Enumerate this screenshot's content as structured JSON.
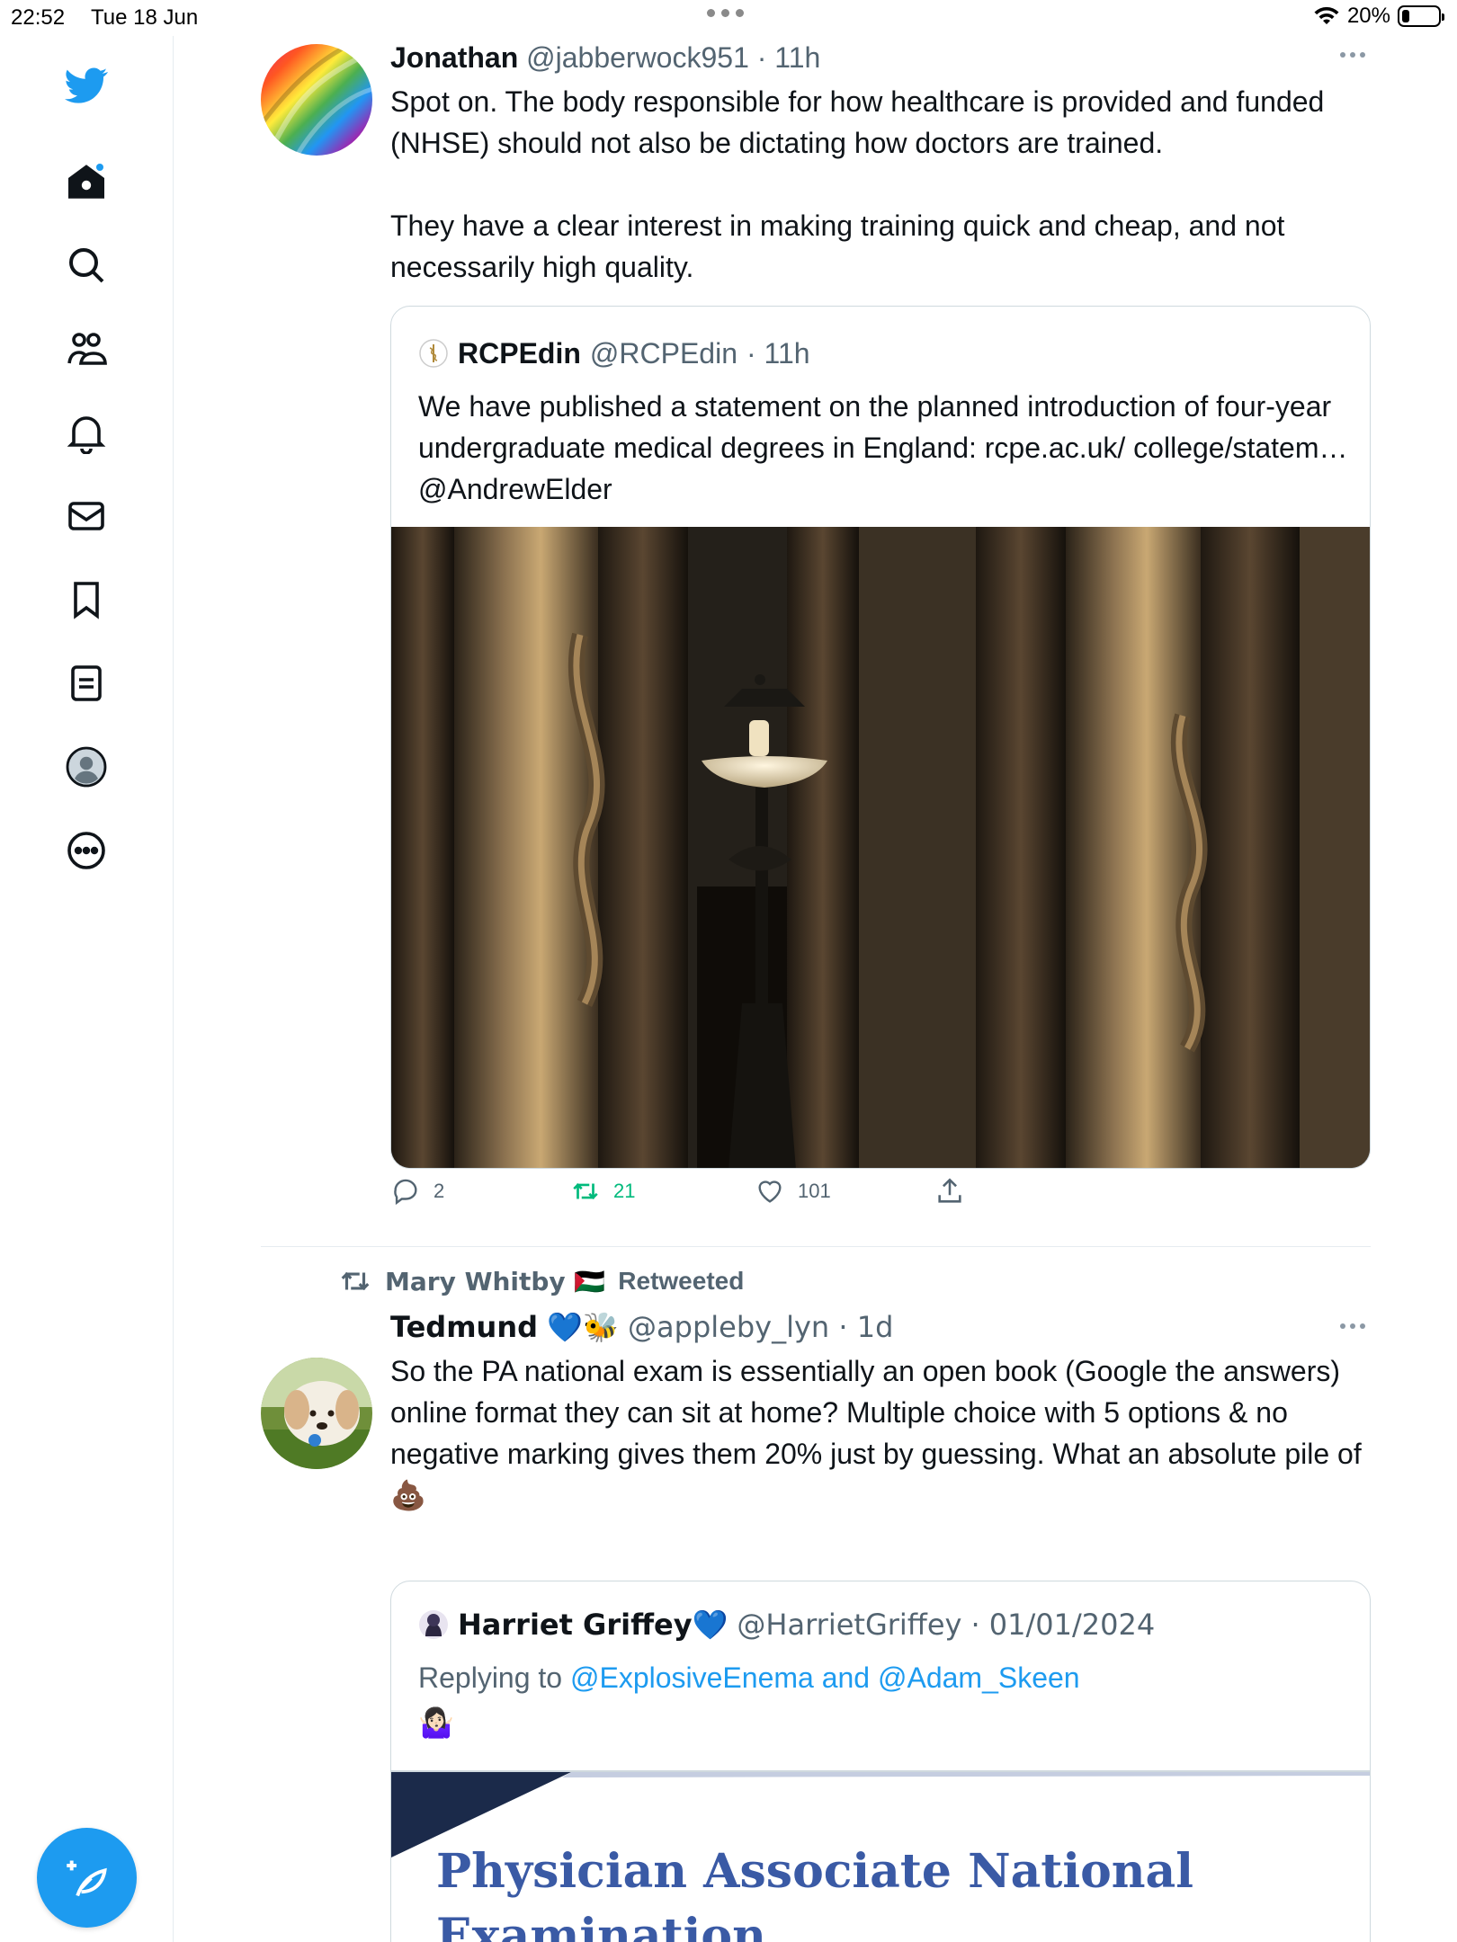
{
  "status_bar": {
    "time": "22:52",
    "date": "Tue 18 Jun",
    "battery": "20%",
    "battery_level": 0.2
  },
  "sidebar": {
    "items": [
      {
        "name": "twitter-logo",
        "icon": "bird-icon"
      },
      {
        "name": "home",
        "icon": "home-icon",
        "badge": true
      },
      {
        "name": "explore",
        "icon": "search-icon"
      },
      {
        "name": "communities",
        "icon": "communities-icon"
      },
      {
        "name": "notifications",
        "icon": "bell-icon"
      },
      {
        "name": "messages",
        "icon": "envelope-icon"
      },
      {
        "name": "bookmarks",
        "icon": "bookmark-icon"
      },
      {
        "name": "lists",
        "icon": "list-icon"
      },
      {
        "name": "profile",
        "icon": "avatar-icon"
      },
      {
        "name": "more",
        "icon": "more-circle-icon"
      }
    ],
    "compose_icon": "feather-plus-icon"
  },
  "colors": {
    "accent": "#1d9bf0",
    "retweet_green": "#00ba7c",
    "muted": "#536471",
    "border": "#cfd9de"
  },
  "tweets": [
    {
      "name": "Jonathan",
      "handle": "@jabberwock951",
      "time": "· 11h",
      "text_p1": "Spot on. The body responsible for how healthcare is provided and funded (NHSE) should not also be dictating how doctors are trained.",
      "text_p2": "They have a clear interest in making training quick and cheap, and not necessarily high quality.",
      "quote": {
        "name": "RCPEdin",
        "handle": "@RCPEdin",
        "time": "· 11h",
        "text": "We have published a statement on the planned introduction of four-year undergraduate medical degrees in England: rcpe.ac.uk/ college/statem… @AndrewElder"
      },
      "replies": "2",
      "retweets": "21",
      "likes": "101"
    },
    {
      "retweeted_by": "Mary Whitby 🇵🇸",
      "retweeted_label": "Retweeted",
      "name": "Tedmund",
      "name_emoji": "💙🐝",
      "handle": "@appleby_lyn",
      "time": "· 1d",
      "text": "So the PA national exam is essentially an open book (Google the answers) online format they can sit at home? Multiple choice with 5 options & no negative marking gives them 20% just by guessing. What an absolute pile of 💩",
      "quote": {
        "name": "Harriet Griffey",
        "name_emoji": "💙",
        "handle": "@HarrietGriffey",
        "time": "· 01/01/2024",
        "replying_label": "Replying to",
        "replying_to": "@ExplosiveEnema and @Adam_Skeen",
        "text": "🤷🏻‍♀️",
        "image_title_line1": "Physician Associate National",
        "image_title_line2": "Examination"
      }
    }
  ]
}
